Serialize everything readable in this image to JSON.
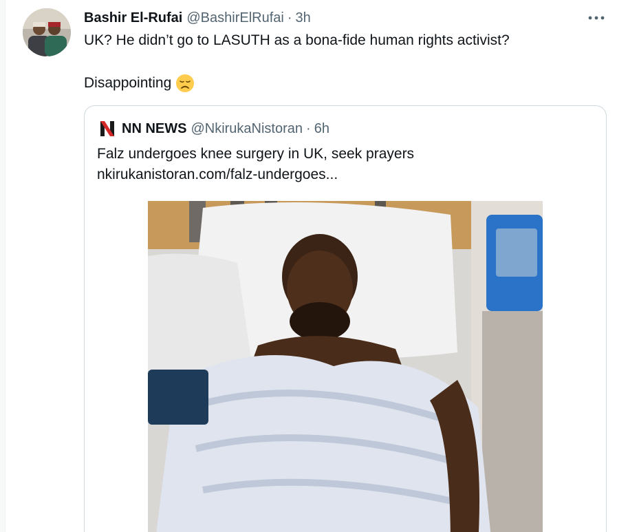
{
  "tweet": {
    "author_name": "Bashir El-Rufai",
    "author_handle": "@BashirElRufai",
    "separator": "·",
    "time": "3h",
    "text_line1": "UK? He didn’t go to LASUTH as a bona-fide human rights activist?",
    "text_line2": "Disappointing",
    "emoji": "disappointed-face-emoji",
    "more_icon": "more-horizontal-icon"
  },
  "quote": {
    "author_name": "NN NEWS",
    "author_handle": "@NkirukaNistoran",
    "separator": "·",
    "time": "6h",
    "logo_icon": "nn-logo-icon",
    "text_line1": "Falz undergoes knee surgery in UK, seek prayers",
    "link_text": "nkirukanistoran.com/falz-undergoes..."
  },
  "colors": {
    "text_primary": "#0f1419",
    "text_secondary": "#536471",
    "border": "#cfd9de",
    "emoji_yellow": "#ffcc4d"
  }
}
